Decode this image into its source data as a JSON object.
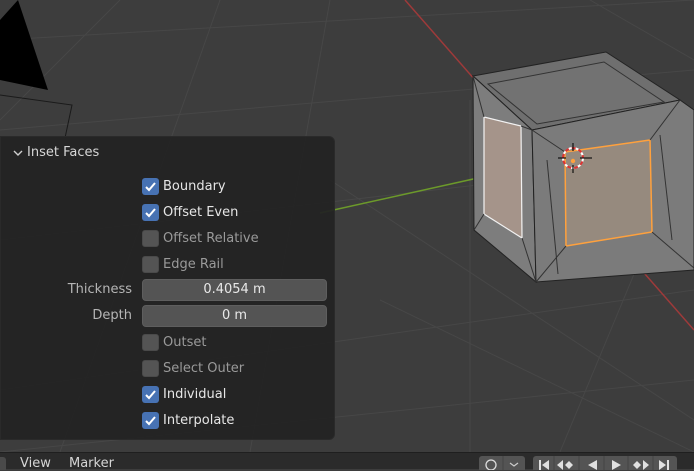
{
  "panel": {
    "title": "Inset Faces",
    "options": [
      {
        "label": "Boundary",
        "checked": true
      },
      {
        "label": "Offset Even",
        "checked": true
      },
      {
        "label": "Offset Relative",
        "checked": false
      },
      {
        "label": "Edge Rail",
        "checked": false
      },
      {
        "label": "Outset",
        "checked": false
      },
      {
        "label": "Select Outer",
        "checked": false
      },
      {
        "label": "Individual",
        "checked": true
      },
      {
        "label": "Interpolate",
        "checked": true
      }
    ],
    "fields": {
      "thickness": {
        "label": "Thickness",
        "value": "0.4054 m"
      },
      "depth": {
        "label": "Depth",
        "value": "0 m"
      }
    }
  },
  "timeline_header": {
    "menus": [
      "View",
      "Marker"
    ],
    "playback_icons": [
      "jump-start-icon",
      "prev-keyframe-icon",
      "play-reverse-icon",
      "play-icon",
      "next-keyframe-icon",
      "jump-end-icon"
    ]
  },
  "colors": {
    "viewport_bg": "#3d3d3d",
    "checkbox_on": "#4772b3",
    "selection": "#ffaa40",
    "x_axis": "#b03a3a",
    "y_axis": "#6c9a2a"
  }
}
